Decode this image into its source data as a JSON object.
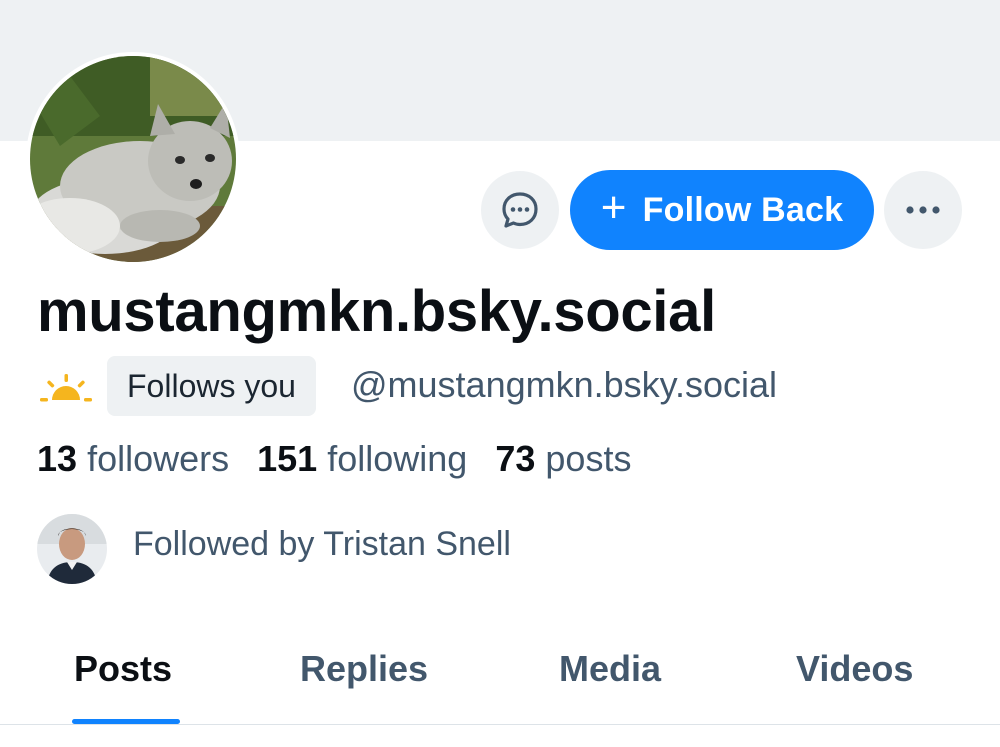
{
  "profile": {
    "display_name": "mustangmkn.bsky.social",
    "handle": "@mustangmkn.bsky.social",
    "follows_you_label": "Follows you",
    "avatar_icon": "arctic-fox-avatar",
    "status_icon": "sunrise-icon"
  },
  "actions": {
    "message_icon": "chat-bubble-icon",
    "follow_label": "Follow Back",
    "follow_icon": "plus-icon",
    "more_icon": "ellipsis-icon"
  },
  "stats": {
    "followers_count": "13",
    "followers_label": "followers",
    "following_count": "151",
    "following_label": "following",
    "posts_count": "73",
    "posts_label": "posts"
  },
  "known_followers": {
    "text": "Followed by Tristan Snell",
    "avatar_icon": "user-avatar"
  },
  "tabs": [
    {
      "label": "Posts",
      "active": true
    },
    {
      "label": "Replies",
      "active": false
    },
    {
      "label": "Media",
      "active": false
    },
    {
      "label": "Videos",
      "active": false
    }
  ],
  "colors": {
    "accent": "#1083fe",
    "banner": "#eef1f3",
    "muted_text": "#42576c",
    "primary_text": "#0b0f14"
  }
}
